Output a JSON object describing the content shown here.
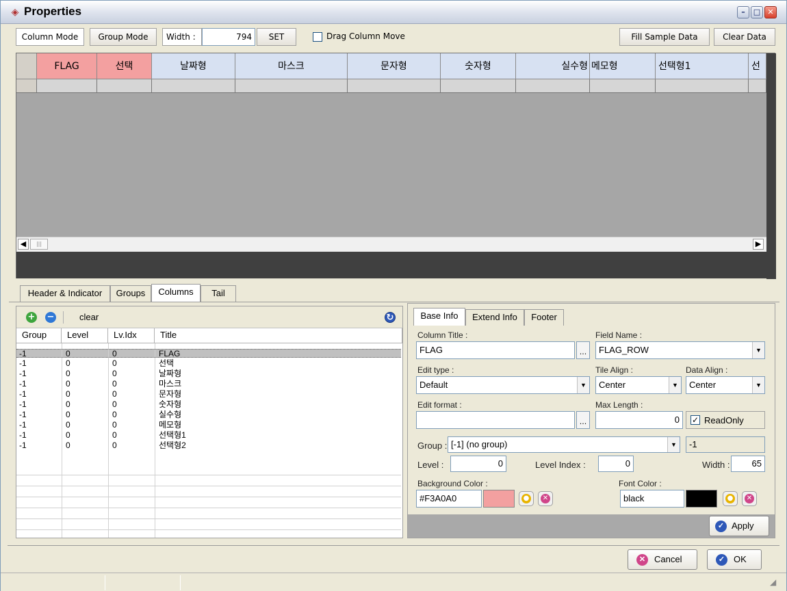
{
  "window": {
    "title": "Properties"
  },
  "toolbar": {
    "column_mode": "Column Mode",
    "group_mode": "Group Mode",
    "width_label": "Width :",
    "width_value": "794",
    "set": "SET",
    "drag_move": "Drag Column Move",
    "fill_sample": "Fill Sample Data",
    "clear_data": "Clear Data"
  },
  "grid": {
    "headers": [
      "FLAG",
      "선택",
      "날짜형",
      "마스크",
      "문자형",
      "숫자형",
      "실수형",
      "메모형",
      "선택형1",
      "선"
    ]
  },
  "tabs": [
    "Header & Indicator",
    "Groups",
    "Columns",
    "Tail"
  ],
  "left_panel": {
    "clear": "clear",
    "columns": [
      "Group",
      "Level",
      "Lv.Idx",
      "Title"
    ],
    "rows": [
      [
        "-1",
        "0",
        "0",
        "FLAG"
      ],
      [
        "-1",
        "0",
        "0",
        "선택"
      ],
      [
        "-1",
        "0",
        "0",
        "날짜형"
      ],
      [
        "-1",
        "0",
        "0",
        "마스크"
      ],
      [
        "-1",
        "0",
        "0",
        "문자형"
      ],
      [
        "-1",
        "0",
        "0",
        "숫자형"
      ],
      [
        "-1",
        "0",
        "0",
        "실수형"
      ],
      [
        "-1",
        "0",
        "0",
        "메모형"
      ],
      [
        "-1",
        "0",
        "0",
        "선택형1"
      ],
      [
        "-1",
        "0",
        "0",
        "선택형2"
      ]
    ]
  },
  "right_panel": {
    "tabs": [
      "Base Info",
      "Extend Info",
      "Footer"
    ],
    "column_title_label": "Column Title :",
    "column_title": "FLAG",
    "field_name_label": "Field Name :",
    "field_name": "FLAG_ROW",
    "edit_type_label": "Edit type :",
    "edit_type": "Default",
    "tile_align_label": "Tile Align :",
    "tile_align": "Center",
    "data_align_label": "Data Align :",
    "data_align": "Center",
    "edit_format_label": "Edit format :",
    "edit_format": "",
    "max_length_label": "Max Length :",
    "max_length": "0",
    "readonly": "ReadOnly",
    "group_label": "Group :",
    "group_value": "[-1] (no group)",
    "group_id": "-1",
    "level_label": "Level :",
    "level": "0",
    "level_index_label": "Level Index :",
    "level_index": "0",
    "width_label": "Width :",
    "width": "65",
    "bg_color_label": "Background Color :",
    "bg_color": "#F3A0A0",
    "font_color_label": "Font Color :",
    "font_color": "black",
    "apply": "Apply"
  },
  "footer": {
    "cancel": "Cancel",
    "ok": "OK"
  },
  "colors": {
    "flag_header": "#f3a0a0",
    "header": "#d7e1f2",
    "font_swatch": "#000000"
  }
}
